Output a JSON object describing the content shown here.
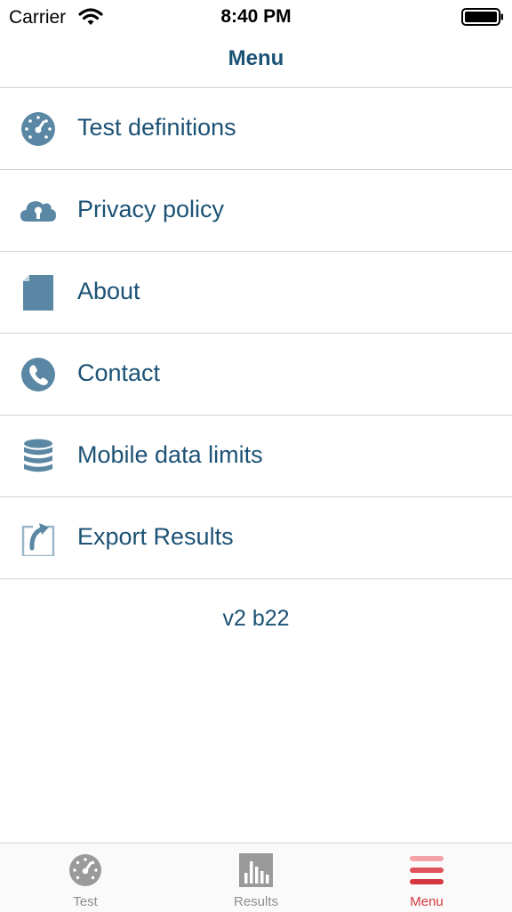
{
  "status_bar": {
    "carrier": "Carrier",
    "time": "8:40 PM",
    "wifi_icon": "wifi-icon",
    "battery_icon": "battery-icon"
  },
  "nav": {
    "title": "Menu"
  },
  "menu": {
    "items": [
      {
        "label": "Test definitions",
        "icon": "speedometer-icon"
      },
      {
        "label": "Privacy policy",
        "icon": "cloud-lock-icon"
      },
      {
        "label": "About",
        "icon": "document-icon"
      },
      {
        "label": "Contact",
        "icon": "phone-icon"
      },
      {
        "label": "Mobile data limits",
        "icon": "database-icon"
      },
      {
        "label": "Export Results",
        "icon": "export-icon"
      }
    ]
  },
  "version": "v2 b22",
  "tab_bar": {
    "tabs": [
      {
        "label": "Test",
        "icon": "speedometer-icon",
        "active": false
      },
      {
        "label": "Results",
        "icon": "bar-chart-icon",
        "active": false
      },
      {
        "label": "Menu",
        "icon": "hamburger-menu-icon",
        "active": true
      }
    ]
  },
  "colors": {
    "primary_text": "#1c5275",
    "icon": "#5a87a3",
    "divider": "#cfd5d9",
    "tab_inactive": "#8e8e8e",
    "tab_active": "#d6363f"
  }
}
